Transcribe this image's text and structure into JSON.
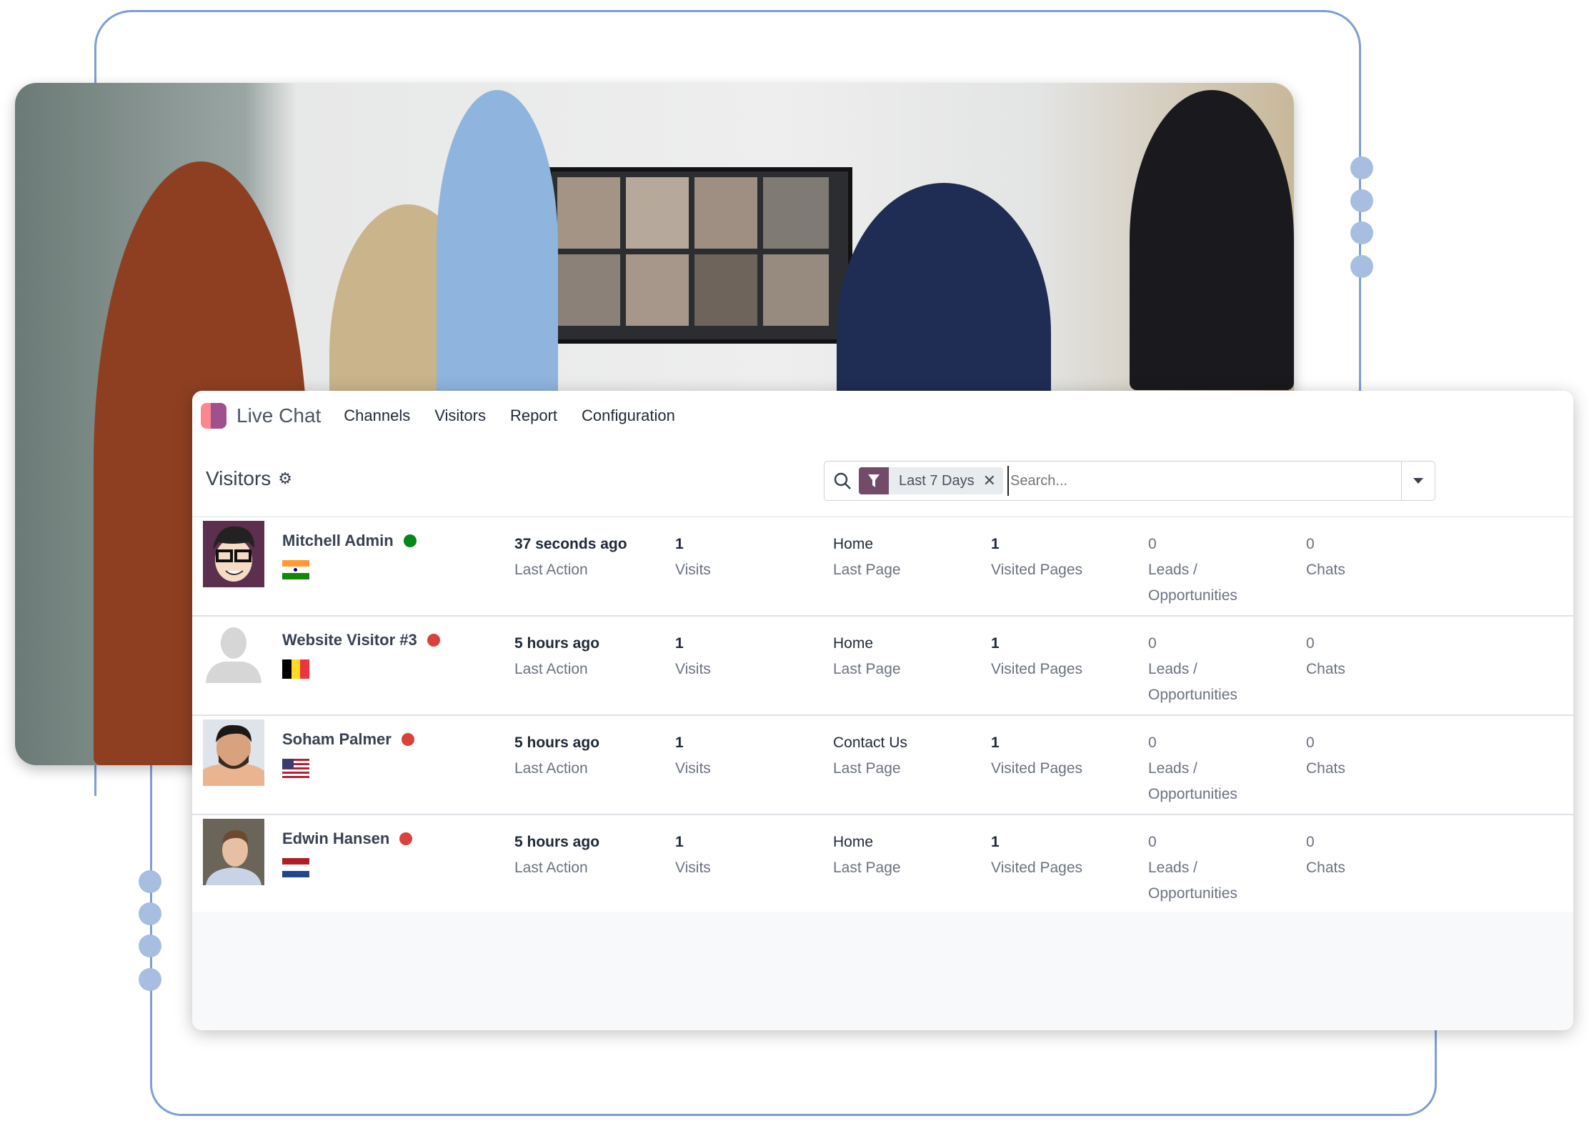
{
  "app": {
    "name": "Live Chat",
    "menu": [
      "Channels",
      "Visitors",
      "Report",
      "Configuration"
    ]
  },
  "control_panel": {
    "breadcrumb": "Visitors",
    "settings_icon": "gear-icon",
    "search": {
      "icon": "search-icon",
      "facet_icon": "filter-icon",
      "facet_label": "Last 7 Days",
      "facet_remove_icon": "close-icon",
      "placeholder": "Search...",
      "value": "",
      "toggle_icon": "caret-down-icon"
    }
  },
  "colors": {
    "brand": "#714b67",
    "online": "#008818",
    "offline": "#d9534f",
    "frame": "#7f9ed4"
  },
  "visitors": [
    {
      "name": "Mitchell Admin",
      "status": "online",
      "country": "India",
      "last_action": "37 seconds ago",
      "last_action_label": "Last Action",
      "visits": "1",
      "visits_label": "Visits",
      "last_page": "Home",
      "last_page_label": "Last Page",
      "visited_pages": "1",
      "visited_pages_label": "Visited Pages",
      "leads": "0",
      "leads_label_1": "Leads /",
      "leads_label_2": "Opportunities",
      "chats": "0",
      "chats_label": "Chats"
    },
    {
      "name": "Website Visitor #3",
      "status": "offline",
      "country": "Belgium",
      "last_action": "5 hours ago",
      "last_action_label": "Last Action",
      "visits": "1",
      "visits_label": "Visits",
      "last_page": "Home",
      "last_page_label": "Last Page",
      "visited_pages": "1",
      "visited_pages_label": "Visited Pages",
      "leads": "0",
      "leads_label_1": "Leads /",
      "leads_label_2": "Opportunities",
      "chats": "0",
      "chats_label": "Chats"
    },
    {
      "name": "Soham Palmer",
      "status": "offline",
      "country": "United States",
      "last_action": "5 hours ago",
      "last_action_label": "Last Action",
      "visits": "1",
      "visits_label": "Visits",
      "last_page": "Contact Us",
      "last_page_label": "Last Page",
      "visited_pages": "1",
      "visited_pages_label": "Visited Pages",
      "leads": "0",
      "leads_label_1": "Leads /",
      "leads_label_2": "Opportunities",
      "chats": "0",
      "chats_label": "Chats"
    },
    {
      "name": "Edwin Hansen",
      "status": "offline",
      "country": "Netherlands",
      "last_action": "5 hours ago",
      "last_action_label": "Last Action",
      "visits": "1",
      "visits_label": "Visits",
      "last_page": "Home",
      "last_page_label": "Last Page",
      "visited_pages": "1",
      "visited_pages_label": "Visited Pages",
      "leads": "0",
      "leads_label_1": "Leads /",
      "leads_label_2": "Opportunities",
      "chats": "0",
      "chats_label": "Chats"
    }
  ]
}
